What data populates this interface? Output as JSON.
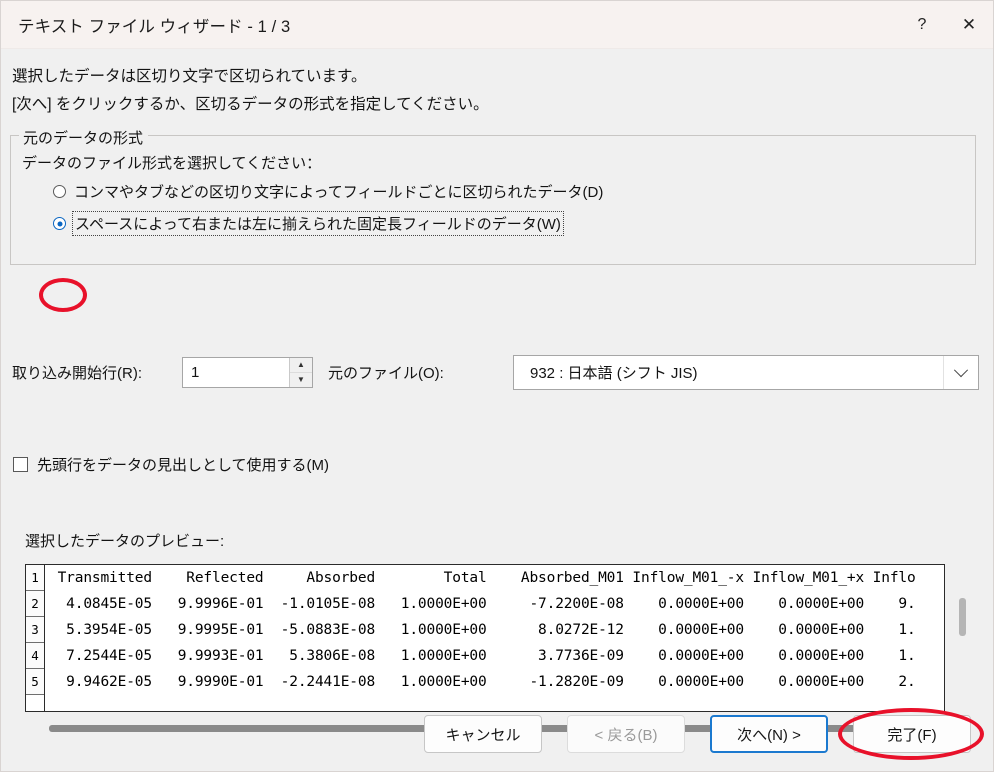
{
  "window": {
    "title": "テキスト ファイル ウィザード - 1 / 3",
    "help_icon": "?",
    "close_icon": "✕"
  },
  "intro": {
    "line1": "選択したデータは区切り文字で区切られています。",
    "line2": "[次へ] をクリックするか、区切るデータの形式を指定してください。"
  },
  "group": {
    "legend": "元のデータの形式",
    "prompt": "データのファイル形式を選択してください：",
    "radios": [
      {
        "label": "コンマやタブなどの区切り文字によってフィールドごとに区切られたデータ(D)",
        "accel": "D",
        "selected": false
      },
      {
        "label": "スペースによって右または左に揃えられた固定長フィールドのデータ(W)",
        "accel": "W",
        "selected": true
      }
    ]
  },
  "start_row": {
    "label": "取り込み開始行(R):",
    "accel": "R",
    "value": "1",
    "spin_up": "▲",
    "spin_down": "▼"
  },
  "origin_file": {
    "label": "元のファイル(O):",
    "accel": "O",
    "value": "932 : 日本語 (シフト JIS)"
  },
  "header_checkbox": {
    "label": "先頭行をデータの見出しとして使用する(M)",
    "accel": "M",
    "checked": false
  },
  "preview": {
    "label": "選択したデータのプレビュー:",
    "row_numbers": [
      "1",
      "2",
      "3",
      "4",
      "5"
    ],
    "rows": [
      " Transmitted    Reflected     Absorbed        Total    Absorbed_M01 Inflow_M01_-x Inflow_M01_+x Inflo",
      "  4.0845E-05   9.9996E-01  -1.0105E-08   1.0000E+00     -7.2200E-08    0.0000E+00    0.0000E+00    9.",
      "  5.3954E-05   9.9995E-01  -5.0883E-08   1.0000E+00      8.0272E-12    0.0000E+00    0.0000E+00    1.",
      "  7.2544E-05   9.9993E-01   5.3806E-08   1.0000E+00      3.7736E-09    0.0000E+00    0.0000E+00    1.",
      "  9.9462E-05   9.9990E-01  -2.2441E-08   1.0000E+00     -1.2820E-09    0.0000E+00    0.0000E+00    2."
    ]
  },
  "buttons": {
    "cancel": "キャンセル",
    "back": "< 戻る(B)",
    "next": "次へ(N) >",
    "finish": "完了(F)"
  },
  "colors": {
    "annotation_red": "#e8112a",
    "focus_blue": "#1b79cf",
    "radio_blue": "#0a66c2"
  }
}
